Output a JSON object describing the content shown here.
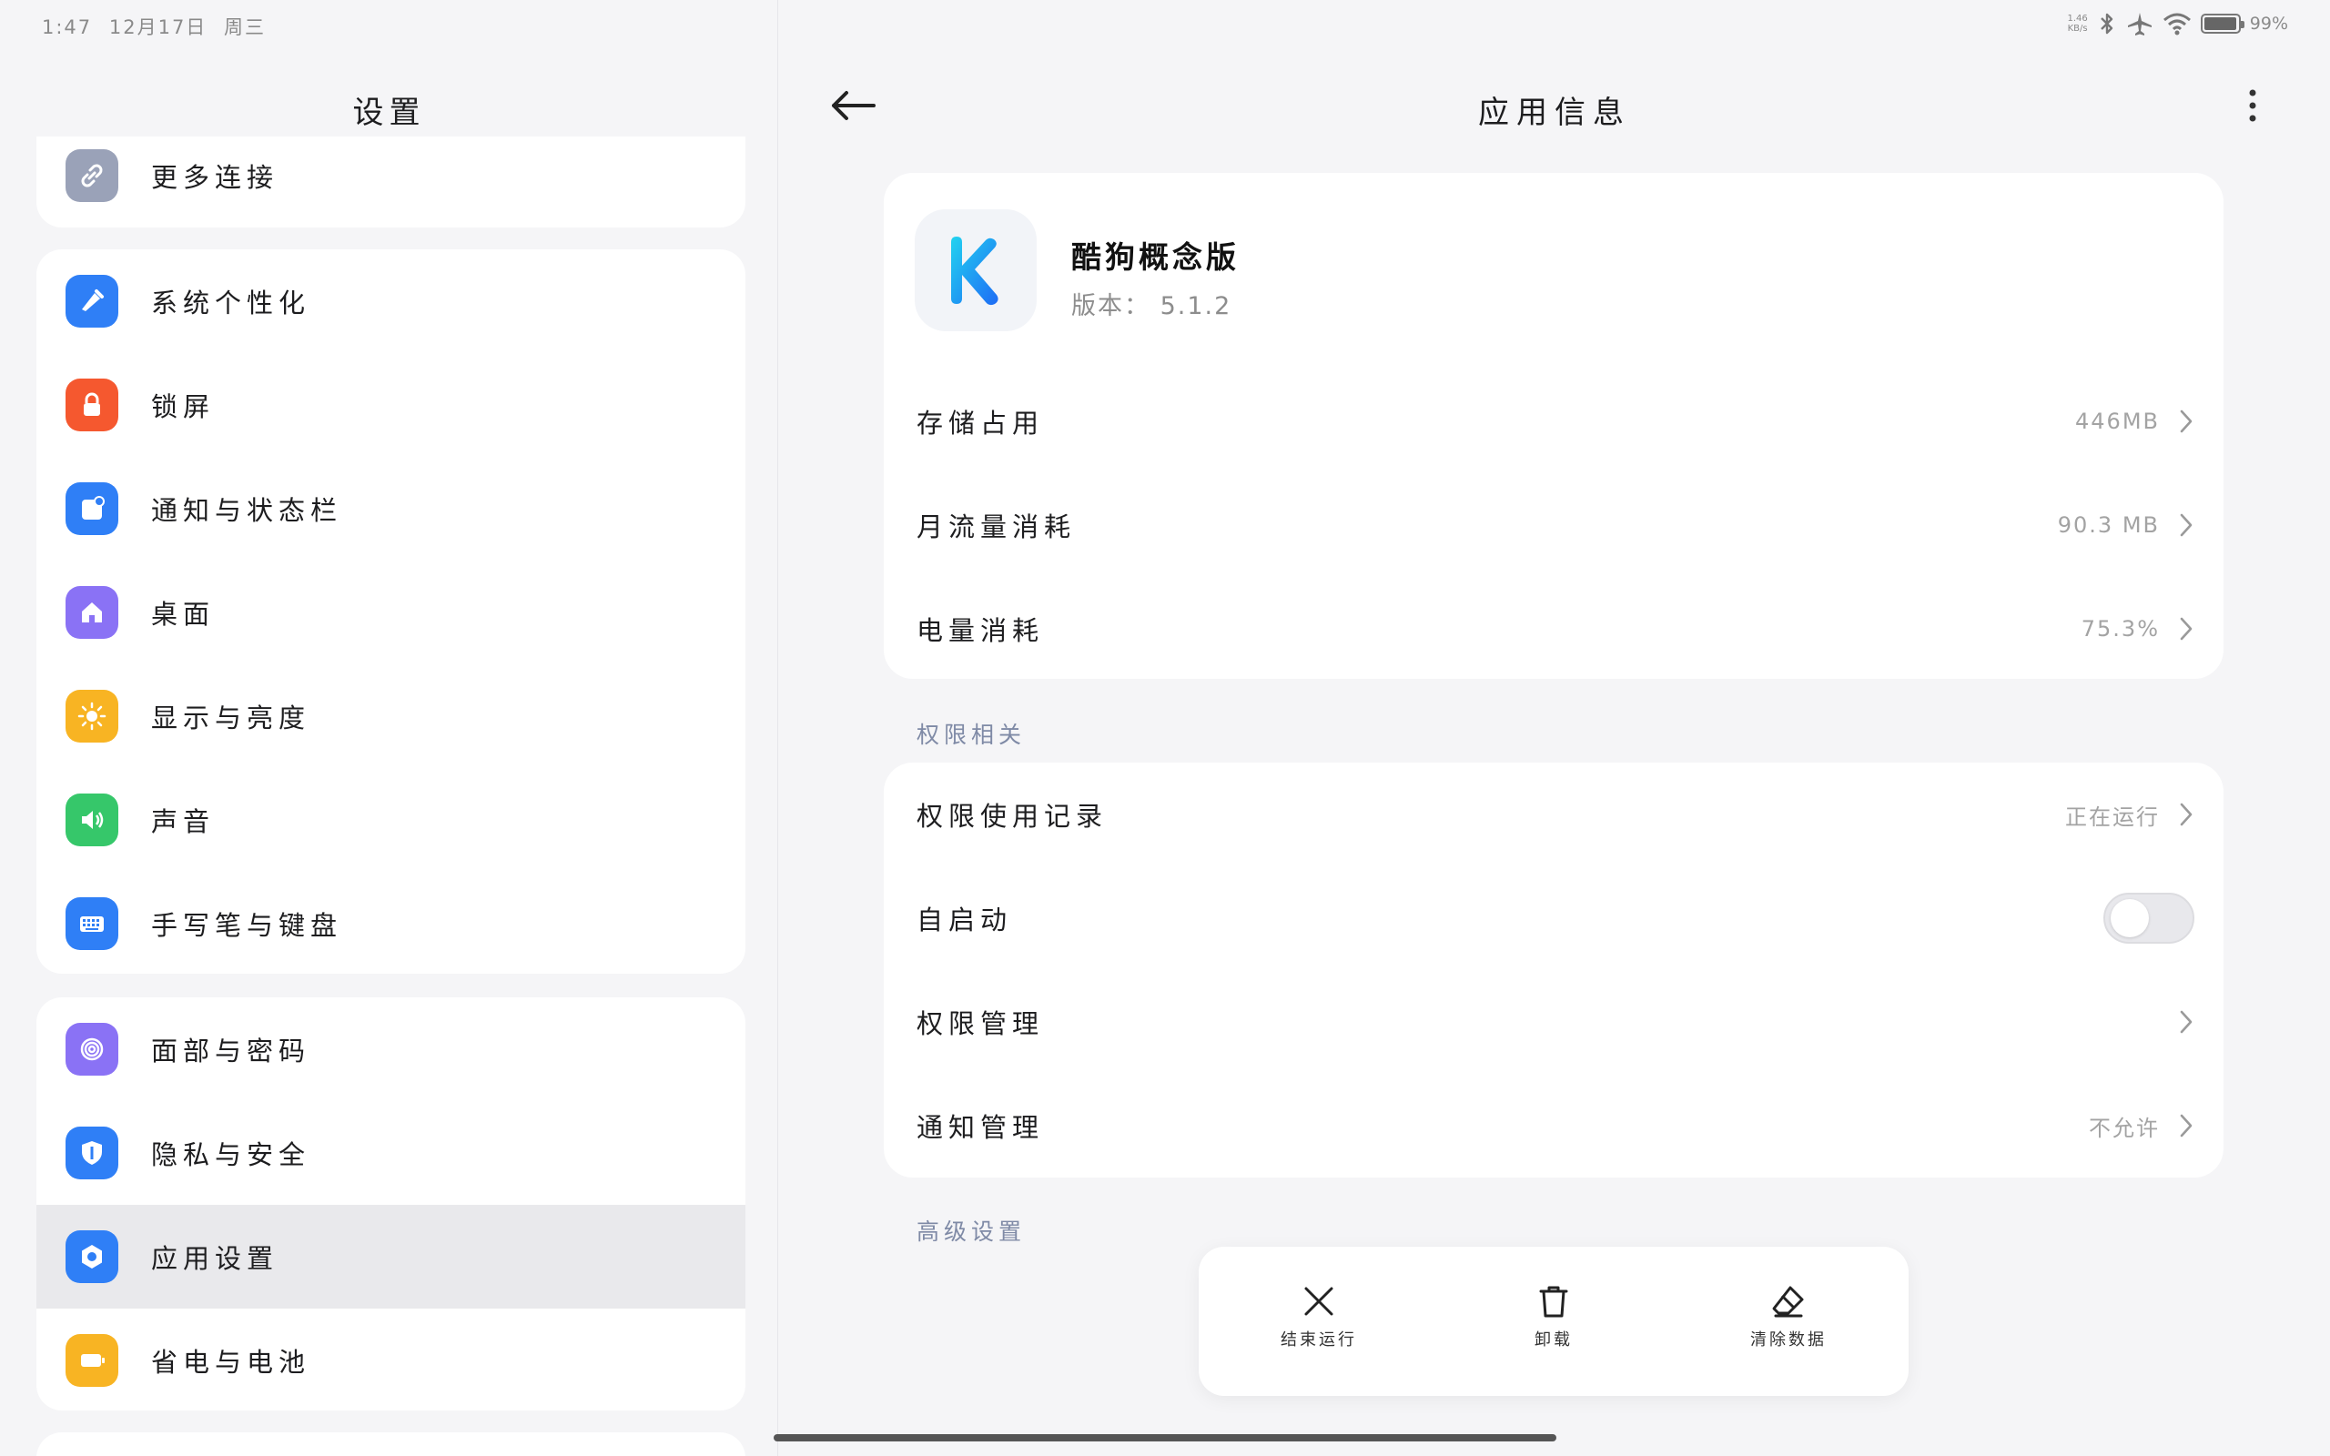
{
  "status_bar": {
    "time": "1:47",
    "date": "12月17日",
    "weekday": "周三",
    "net_speed_value": "1.46",
    "net_speed_unit": "KB/s",
    "battery": "99%",
    "battery_level": 0.99
  },
  "settings_pane": {
    "title": "设置",
    "group0": [
      {
        "label": "更多连接",
        "icon": "link-icon",
        "color": "#9aa2b8"
      }
    ],
    "group1": [
      {
        "label": "系统个性化",
        "icon": "brush-icon",
        "color": "#2f7ff6"
      },
      {
        "label": "锁屏",
        "icon": "lock-icon",
        "color": "#f5582f"
      },
      {
        "label": "通知与状态栏",
        "icon": "notification-icon",
        "color": "#2f7ff6"
      },
      {
        "label": "桌面",
        "icon": "home-icon",
        "color": "#8a72f5"
      },
      {
        "label": "显示与亮度",
        "icon": "sun-icon",
        "color": "#f8b423"
      },
      {
        "label": "声音",
        "icon": "speaker-icon",
        "color": "#36c76a"
      },
      {
        "label": "手写笔与键盘",
        "icon": "keyboard-icon",
        "color": "#2f7ff6"
      }
    ],
    "group2": [
      {
        "label": "面部与密码",
        "icon": "fingerprint-icon",
        "color": "#8a72f5"
      },
      {
        "label": "隐私与安全",
        "icon": "shield-icon",
        "color": "#2f7ff6"
      },
      {
        "label": "应用设置",
        "icon": "hexagon-icon",
        "color": "#2f7ff6"
      },
      {
        "label": "省电与电池",
        "icon": "battery-icon",
        "color": "#f8b423"
      }
    ]
  },
  "app_info": {
    "title": "应用信息",
    "app_name": "酷狗概念版",
    "version": "版本： 5.1.2",
    "usage_rows": [
      {
        "label": "存储占用",
        "value": "446MB"
      },
      {
        "label": "月流量消耗",
        "value": "90.3 MB"
      },
      {
        "label": "电量消耗",
        "value": "75.3%"
      }
    ],
    "permissions_section": "权限相关",
    "permission_rows": [
      {
        "label": "权限使用记录",
        "value": "正在运行"
      },
      {
        "label": "自启动",
        "value": ""
      },
      {
        "label": "权限管理",
        "value": ""
      },
      {
        "label": "通知管理",
        "value": "不允许"
      }
    ],
    "autostart_enabled": false,
    "advanced_section": "高级设置",
    "actions": [
      {
        "label": "结束运行",
        "icon": "close-icon"
      },
      {
        "label": "卸载",
        "icon": "trash-icon"
      },
      {
        "label": "清除数据",
        "icon": "eraser-icon"
      }
    ]
  },
  "colors": {
    "background": "#f5f5f7",
    "card": "#ffffff",
    "accent": "#2f7ff6",
    "section_label": "#7f8aa6",
    "value_text": "#a3a3a3"
  }
}
